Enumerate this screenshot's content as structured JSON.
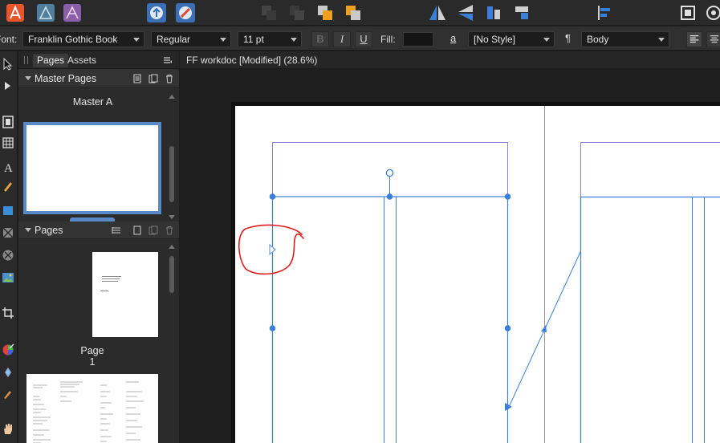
{
  "toolbar": {
    "personas": [
      {
        "name": "publisher-persona-icon",
        "color": "#e8542c"
      },
      {
        "name": "designer-persona-icon",
        "color": "#4f7f9c"
      },
      {
        "name": "photo-persona-icon",
        "color": "#8b5fa8"
      }
    ],
    "accent": "#3b7fd8"
  },
  "context": {
    "font_label": "Font:",
    "font_value": "Franklin Gothic Book",
    "style_value": "Regular",
    "size_value": "11 pt",
    "bold": "B",
    "italic": "I",
    "underline": "U",
    "fill_label": "Fill:",
    "fill_color": "#141414",
    "char_style_icon": "a",
    "char_style_value": "[No Style]",
    "para_icon": "¶",
    "para_style_value": "Body"
  },
  "panel": {
    "tabs": [
      {
        "label": "Pages",
        "active": true
      },
      {
        "label": "Assets",
        "active": false
      }
    ],
    "master_section": {
      "title": "Master Pages",
      "master_name": "Master A"
    },
    "pages_section": {
      "title": "Pages",
      "page1_label": "Page 1"
    }
  },
  "document": {
    "title": "FF workdoc [Modified] (28.6%)"
  },
  "canvas": {
    "page_color": "#ffffff",
    "guide_color": "#3b7fd8",
    "margin_color": "#8f7fdc",
    "annotation_color": "#e01c1c"
  }
}
